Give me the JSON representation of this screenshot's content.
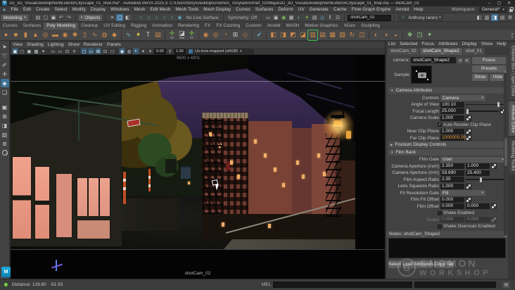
{
  "window": {
    "title": "2D_3D_VisualDevelopmentExteriorCityscape_01_final.ma* - Autodesk MAYA 2025.3: C:\\Users\\tony\\Desktop\\Gnomon_TonyIaniro\\Part_02\\Maya\\2D_3D_VisualDevelopmentExteriorCityscape_01_final.ma — shotCam_02",
    "doc_icon": "M",
    "controls": {
      "minimize": "–",
      "maximize": "▢",
      "close": "✕"
    }
  },
  "menubar": {
    "items": [
      "File",
      "Edit",
      "Create",
      "Select",
      "Modify",
      "Display",
      "Windows",
      "Mesh",
      "Edit Mesh",
      "Mesh Tools",
      "Mesh Display",
      "Curves",
      "Surfaces",
      "Deform",
      "UV",
      "Generate",
      "Cache",
      "Flow Graph Engine",
      "Arnold",
      "Help"
    ],
    "workspace_label": "Workspace:",
    "workspace_value": "General*"
  },
  "toolbar": {
    "mode": "Modeling",
    "mask": "Objects",
    "no_live": "No Live Surface",
    "symmetry": "Symmetry: Off",
    "camera_field": "shotCam_02",
    "user": "Anthony Ianiro",
    "file_icons": [
      {
        "n": "new-scene-icon",
        "g": "▤"
      },
      {
        "n": "open-scene-icon",
        "g": "▢"
      },
      {
        "n": "save-scene-icon",
        "g": "▣"
      },
      {
        "n": "undo-icon",
        "g": "↶"
      },
      {
        "n": "redo-icon",
        "g": "↷"
      }
    ],
    "selmask_icons": [
      {
        "n": "select-hierarchy-icon",
        "g": "≡"
      },
      {
        "n": "select-object-icon",
        "g": "▢",
        "hl": true
      },
      {
        "n": "select-component-icon",
        "g": "◧"
      }
    ],
    "snap_icons": [
      {
        "n": "snap-grid-icon",
        "g": "∩",
        "c": "teal"
      },
      {
        "n": "snap-curve-icon",
        "g": "∩",
        "c": "teal"
      },
      {
        "n": "snap-point-icon",
        "g": "∩",
        "c": "teal"
      },
      {
        "n": "snap-projected-center-icon",
        "g": "∩",
        "c": "teal"
      },
      {
        "n": "snap-view-plane-icon",
        "g": "∩",
        "c": "teal"
      },
      {
        "n": "make-live-icon",
        "g": "◉",
        "c": "teal"
      }
    ],
    "render_icons": [
      {
        "n": "render-view-icon",
        "g": "▭"
      },
      {
        "n": "render-current-frame-icon",
        "g": "▣"
      },
      {
        "n": "ipr-render-icon",
        "g": "◉",
        "c": "green"
      },
      {
        "n": "render-settings-icon",
        "g": "▦"
      },
      {
        "n": "hypershade-icon",
        "g": "◐",
        "c": "teal"
      },
      {
        "n": "light-editor-icon",
        "g": "✦",
        "c": "green"
      },
      {
        "n": "render-setup-icon",
        "g": "▤"
      },
      {
        "n": "look-dev-icon",
        "g": "◎",
        "c": "teal"
      },
      {
        "n": "pause-viewport-icon",
        "g": "‖"
      },
      {
        "n": "film-slate-icon",
        "g": "⊡"
      }
    ],
    "right_icons": [
      {
        "n": "toggle-channel-box-icon",
        "g": "◧"
      },
      {
        "n": "toggle-tool-settings-icon",
        "g": "▥"
      },
      {
        "n": "toggle-attribute-editor-icon",
        "g": "◨",
        "hl": true
      },
      {
        "n": "toggle-modeling-toolkit-icon",
        "g": "▤"
      },
      {
        "n": "preferences-gear-icon",
        "g": "⚙"
      }
    ]
  },
  "shelf": {
    "active": "Poly Modeling",
    "tabs": [
      "Curves",
      "Surfaces",
      "Poly Modeling",
      "Cleanup",
      "UV Editing",
      "Rigging",
      "Animation",
      "Rendering",
      "FX",
      "FX Caching",
      "Custom",
      "Arnold",
      "MASH",
      "Motion Graphics",
      "XGen",
      "Sculpting"
    ],
    "icons": [
      {
        "n": "poly-sphere-icon",
        "g": "●",
        "c": "orange"
      },
      {
        "n": "poly-cube-icon",
        "g": "■",
        "c": "orange"
      },
      {
        "n": "poly-cylinder-icon",
        "g": "▮",
        "c": "orange"
      },
      {
        "n": "poly-cone-icon",
        "g": "▲",
        "c": "orange"
      },
      {
        "n": "poly-torus-icon",
        "g": "◎",
        "c": "orange"
      },
      {
        "n": "poly-plane-icon",
        "g": "▬",
        "c": "orange"
      },
      {
        "n": "poly-disc-icon",
        "g": "◉",
        "c": "orange"
      },
      {
        "n": "poly-gear-icon",
        "g": "✱",
        "c": "orange"
      },
      {
        "n": "poly-pipe-icon",
        "g": "▯",
        "c": "orange"
      },
      {
        "n": "poly-helix-icon",
        "g": "∿",
        "c": "orange"
      },
      {
        "n": "poly-soccerball-icon",
        "g": "◍",
        "c": "orange"
      },
      {
        "n": "poly-platonic-icon",
        "g": "◆",
        "c": "orange"
      },
      {
        "sep": true
      },
      {
        "n": "ep-curve-icon",
        "g": "∿",
        "c": "blue"
      },
      {
        "n": "star-primitive-icon",
        "g": "✦",
        "c": "yellow"
      },
      {
        "n": "text-tool-icon",
        "g": "T",
        "c": "white"
      },
      {
        "n": "type-tool-icon",
        "g": "▤",
        "c": "orange"
      },
      {
        "sep": true
      },
      {
        "n": "construction-plane-button",
        "g": "✛",
        "c": "green",
        "label": "CP"
      },
      {
        "n": "material-button",
        "g": "◪",
        "c": "white",
        "label": "Mat"
      },
      {
        "n": "follow-focus-button",
        "g": "✛",
        "c": "green",
        "label": "FF"
      },
      {
        "sep": true
      },
      {
        "n": "combine-icon",
        "g": "◉",
        "c": "orange"
      },
      {
        "n": "separate-icon",
        "g": "◎",
        "c": "orange"
      },
      {
        "n": "smooth-icon",
        "g": "◔",
        "c": "orange"
      },
      {
        "n": "uv-grid-icon",
        "g": "⊞",
        "c": "white"
      },
      {
        "n": "multi-cut-icon",
        "g": "◇",
        "c": "orange"
      },
      {
        "sep": true
      },
      {
        "n": "quad-draw-icon",
        "g": "✔",
        "c": "blue"
      },
      {
        "sep": true
      },
      {
        "n": "extrude-icon",
        "g": "◧",
        "c": "orange"
      },
      {
        "n": "bridge-icon",
        "g": "◨",
        "c": "orange"
      },
      {
        "n": "append-polygon-icon",
        "g": "◩",
        "c": "orange"
      },
      {
        "n": "bevel-icon",
        "g": "◪",
        "c": "orange"
      },
      {
        "n": "insert-edge-loop-icon",
        "g": "▥",
        "c": "orange",
        "hl": true
      },
      {
        "n": "offset-edge-loop-icon",
        "g": "▤",
        "c": "orange"
      },
      {
        "n": "edit-edge-flow-icon",
        "g": "▦",
        "c": "orange"
      },
      {
        "n": "slide-edge-icon",
        "g": "▧",
        "c": "orange"
      },
      {
        "n": "spin-edge-icon",
        "g": "↻",
        "c": "orange"
      },
      {
        "n": "mirror-icon",
        "g": "◫",
        "c": "orange"
      },
      {
        "sep": true
      },
      {
        "n": "boolean-union-icon",
        "g": "◐",
        "c": "orange"
      },
      {
        "n": "boolean-difference-icon",
        "g": "◑",
        "c": "orange"
      },
      {
        "n": "boolean-intersect-icon",
        "g": "◒",
        "c": "orange"
      },
      {
        "sep": true
      },
      {
        "n": "bifrost-graph-icon",
        "g": "❖",
        "c": "green2"
      },
      {
        "n": "bifrost-board-icon",
        "g": "◳",
        "c": "green2"
      },
      {
        "n": "mash-network-icon",
        "g": "✦",
        "c": "green2"
      }
    ]
  },
  "toolbox": {
    "tools": [
      {
        "n": "select-tool",
        "g": "➤"
      },
      {
        "n": "lasso-select-tool",
        "g": "➰"
      },
      {
        "n": "paint-select-tool",
        "g": "✐"
      },
      {
        "n": "move-tool",
        "g": "✛"
      },
      {
        "n": "rotate-tool",
        "g": "◈",
        "hl": true
      },
      {
        "n": "scale-tool",
        "g": "❏"
      }
    ],
    "layouts": [
      {
        "n": "layout-single-pane",
        "g": "▣"
      },
      {
        "n": "layout-four-pane",
        "g": "⊞"
      },
      {
        "n": "layout-outliner-persp",
        "g": "◨"
      },
      {
        "n": "layout-hypershade-persp",
        "g": "▥"
      },
      {
        "n": "layout-outliner",
        "g": "≣"
      }
    ]
  },
  "viewport": {
    "menus": [
      "View",
      "Shading",
      "Lighting",
      "Show",
      "Renderer",
      "Panels"
    ],
    "icons": [
      {
        "n": "fit-view-icon",
        "g": "▣",
        "hl": true
      },
      {
        "n": "wireframe-icon",
        "g": "◻"
      },
      {
        "n": "shaded-icon",
        "g": "◼"
      },
      {
        "n": "textured-icon",
        "g": "▩"
      },
      {
        "n": "lights-icon",
        "g": "✦"
      },
      {
        "sep": true
      },
      {
        "n": "camera-attributes-icon",
        "g": "▭"
      },
      {
        "n": "bookmarks-icon",
        "g": "▭"
      },
      {
        "n": "image-plane-icon",
        "g": "⊡"
      },
      {
        "n": "two-d-pan-zoom-icon",
        "g": "✛"
      },
      {
        "sep": true
      },
      {
        "n": "resolution-gate-icon",
        "g": "◻",
        "hl": true
      },
      {
        "n": "film-gate-icon",
        "g": "▭",
        "hl": true
      },
      {
        "n": "gate-mask-icon",
        "g": "⊞",
        "hl": true
      },
      {
        "n": "safe-action-icon",
        "g": "⊡"
      },
      {
        "n": "safe-title-icon",
        "g": "◻"
      },
      {
        "sep": true
      },
      {
        "n": "isolate-select-icon",
        "g": "◉",
        "hl": true
      },
      {
        "n": "xray-icon",
        "g": "◍"
      },
      {
        "n": "ssao-icon",
        "g": "◐",
        "hl": true
      },
      {
        "n": "motion-blur-icon",
        "g": "✦"
      }
    ],
    "exposure_icon": "☀",
    "exposure": "0.00",
    "gamma_icon": "γ",
    "gamma": "1.00",
    "view_transform": "Un-tone-mapped (sRGB)",
    "resolution": "9600 x 4001",
    "camera_label": "shotCam_02"
  },
  "attribute_editor": {
    "menus": [
      "List",
      "Selected",
      "Focus",
      "Attributes",
      "Display",
      "Show",
      "Help"
    ],
    "tabs": [
      "shotCam_02",
      "shotCam_Shape2",
      "shot_01"
    ],
    "active_tab": "shotCam_Shape2",
    "camera_label": "camera:",
    "camera_value": "shotCam_Shape2",
    "buttons": {
      "focus": "Focus",
      "presets": "Presets",
      "show": "Show",
      "hide": "Hide"
    },
    "sample_label": "Sample",
    "sections": [
      {
        "title": "Camera Attributes",
        "state": "expanded",
        "rows": [
          {
            "t": "dd",
            "label": "Controls",
            "value": "Camera"
          },
          {
            "t": "fs",
            "label": "Angle of View",
            "v1": "100.10",
            "slider": 0.82
          },
          {
            "t": "fs",
            "label": "Focal Length",
            "v1": "25.000",
            "slider": 0.06,
            "map": true
          },
          {
            "t": "f1",
            "label": "Camera Scale",
            "v1": "1.000",
            "map": true
          },
          {
            "t": "chk",
            "label": "Auto Render Clip Plane",
            "checked": true
          },
          {
            "t": "f1",
            "label": "Near Clip Plane",
            "v1": "1.000",
            "map": true
          },
          {
            "t": "f1",
            "label": "Far Clip Plane",
            "v1": "1000000.000",
            "map": true,
            "hl": true
          }
        ]
      },
      {
        "title": "Frustum Display Controls",
        "state": "collapsed",
        "rows": []
      },
      {
        "title": "Film Back",
        "state": "expanded",
        "rows": [
          {
            "t": "dd-wide",
            "label": "Film Gate",
            "value": "User"
          },
          {
            "t": "f2",
            "label": "Camera Aperture (inch)",
            "v1": "2.350",
            "v2": "1.000",
            "map": true
          },
          {
            "t": "f2",
            "label": "Camera Aperture (mm)",
            "v1": "59.690",
            "v2": "25.400"
          },
          {
            "t": "fs",
            "label": "Film Aspect Ratio",
            "v1": "2.35",
            "slider": 0.38
          },
          {
            "t": "f1",
            "label": "Lens Squeeze Ratio",
            "v1": "1.000",
            "map": true
          },
          {
            "t": "dd",
            "label": "Fit Resolution Gate",
            "value": "Fill"
          },
          {
            "t": "f1",
            "label": "Film Fit Offset",
            "v1": "0.000",
            "map": true
          },
          {
            "t": "f2",
            "label": "Film Offset",
            "v1": "0.000",
            "v2": "0.000",
            "map": true
          },
          {
            "t": "chk",
            "label": "Shake Enabled",
            "checked": false
          },
          {
            "t": "f2",
            "label": "Shake",
            "v1": "0.000",
            "v2": "0.000",
            "map": true,
            "disabled": true
          },
          {
            "t": "chk",
            "label": "Shake Overscan Enabled",
            "checked": false
          }
        ]
      }
    ],
    "notes_label": "Notes:  shotCam_Shape2",
    "footer": [
      "Select",
      "Load Attributes",
      "Copy Tab"
    ]
  },
  "side_tabs": [
    {
      "label": "Channel Box / Layer Editor",
      "active": false
    },
    {
      "label": "Attribute Editor",
      "active": true
    },
    {
      "label": "Modeling Toolkit",
      "active": false
    }
  ],
  "status_bar": {
    "distance": "Distance: 129.60",
    "delta": "-51.93",
    "mel_label": "MEL"
  },
  "watermark": {
    "g": "G",
    "line1": "GNOMON",
    "line2": "WORKSHOP"
  },
  "colors": {
    "accent_blue": "#3f7296",
    "shelf_orange": "#cf8a4a",
    "snap_teal": "#5fa8c0",
    "highlight_green": "#3bc24d",
    "value_highlight": "#f0a040"
  }
}
